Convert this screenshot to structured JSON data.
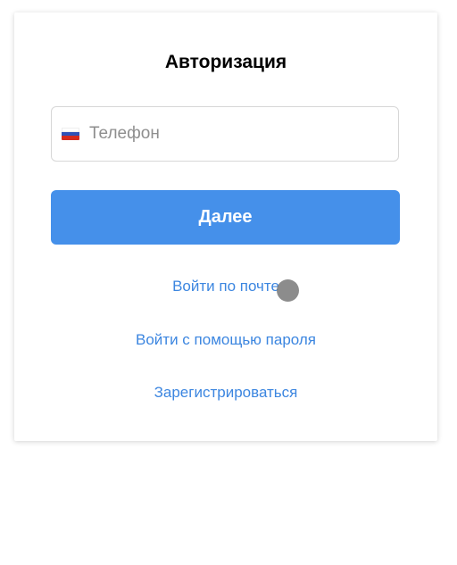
{
  "auth": {
    "title": "Авторизация",
    "phone_placeholder": "Телефон",
    "phone_value": "",
    "country_flag": "russia-flag-icon",
    "next_label": "Далее",
    "links": {
      "email_login": "Войти по почте",
      "password_login": "Войти с помощью пароля",
      "register": "Зарегистрироваться"
    }
  },
  "colors": {
    "accent": "#4590ea",
    "link": "#3c86e0",
    "field_border": "#d7d7d7"
  }
}
